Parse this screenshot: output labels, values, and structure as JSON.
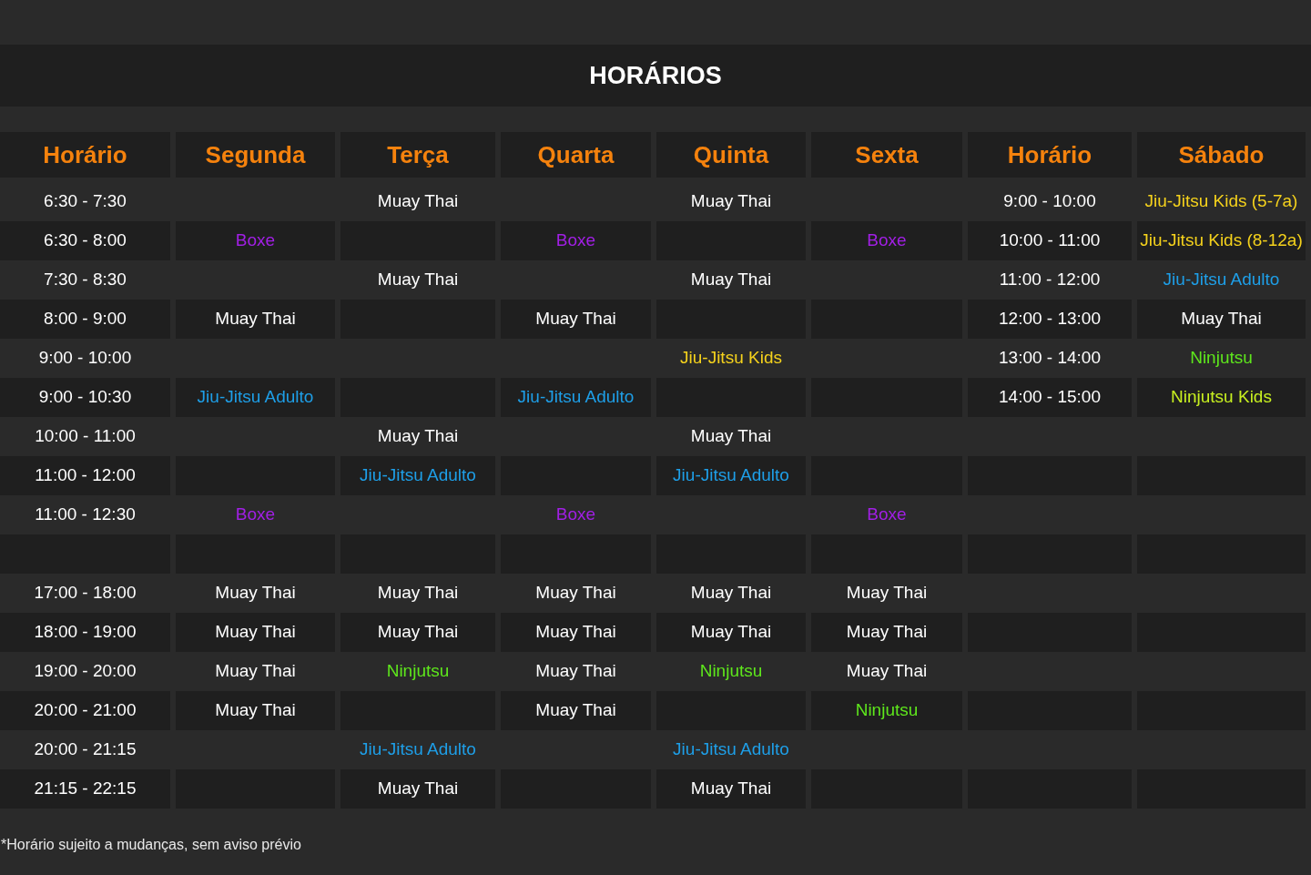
{
  "title": "HORÁRIOS",
  "columns": [
    "Horário",
    "Segunda",
    "Terça",
    "Quarta",
    "Quinta",
    "Sexta",
    "Horário",
    "Sábado"
  ],
  "rows": [
    {
      "cells": [
        {
          "text": "6:30 - 7:30",
          "color": "#ffffff"
        },
        null,
        {
          "text": "Muay Thai",
          "color": "#ffffff"
        },
        null,
        {
          "text": "Muay Thai",
          "color": "#ffffff"
        },
        null,
        {
          "text": "9:00 - 10:00",
          "color": "#ffffff"
        },
        {
          "text": "Jiu-Jitsu Kids (5-7a)",
          "color": "#f5d21c"
        }
      ]
    },
    {
      "cells": [
        {
          "text": "6:30 - 8:00",
          "color": "#ffffff"
        },
        {
          "text": "Boxe",
          "color": "#a21fe6"
        },
        null,
        {
          "text": "Boxe",
          "color": "#a21fe6"
        },
        null,
        {
          "text": "Boxe",
          "color": "#a21fe6"
        },
        {
          "text": "10:00 - 11:00",
          "color": "#ffffff"
        },
        {
          "text": "Jiu-Jitsu Kids (8-12a)",
          "color": "#f5d21c"
        }
      ]
    },
    {
      "cells": [
        {
          "text": "7:30 - 8:30",
          "color": "#ffffff"
        },
        null,
        {
          "text": "Muay Thai",
          "color": "#ffffff"
        },
        null,
        {
          "text": "Muay Thai",
          "color": "#ffffff"
        },
        null,
        {
          "text": "11:00 - 12:00",
          "color": "#ffffff"
        },
        {
          "text": "Jiu-Jitsu Adulto",
          "color": "#1e9fe8"
        }
      ]
    },
    {
      "cells": [
        {
          "text": "8:00 - 9:00",
          "color": "#ffffff"
        },
        {
          "text": "Muay Thai",
          "color": "#ffffff"
        },
        null,
        {
          "text": "Muay Thai",
          "color": "#ffffff"
        },
        null,
        null,
        {
          "text": "12:00 - 13:00",
          "color": "#ffffff"
        },
        {
          "text": "Muay Thai",
          "color": "#ffffff"
        }
      ]
    },
    {
      "cells": [
        {
          "text": "9:00 - 10:00",
          "color": "#ffffff"
        },
        null,
        null,
        null,
        {
          "text": "Jiu-Jitsu Kids",
          "color": "#f5d21c"
        },
        null,
        {
          "text": "13:00 - 14:00",
          "color": "#ffffff"
        },
        {
          "text": "Ninjutsu",
          "color": "#5ee61c"
        }
      ]
    },
    {
      "cells": [
        {
          "text": "9:00 - 10:30",
          "color": "#ffffff"
        },
        {
          "text": "Jiu-Jitsu Adulto",
          "color": "#1e9fe8"
        },
        null,
        {
          "text": "Jiu-Jitsu Adulto",
          "color": "#1e9fe8"
        },
        null,
        null,
        {
          "text": "14:00 - 15:00",
          "color": "#ffffff"
        },
        {
          "text": "Ninjutsu Kids",
          "color": "#c8f020"
        }
      ]
    },
    {
      "cells": [
        {
          "text": "10:00 - 11:00",
          "color": "#ffffff"
        },
        null,
        {
          "text": "Muay Thai",
          "color": "#ffffff"
        },
        null,
        {
          "text": "Muay Thai",
          "color": "#ffffff"
        },
        null,
        null,
        null
      ]
    },
    {
      "cells": [
        {
          "text": "11:00 - 12:00",
          "color": "#ffffff"
        },
        null,
        {
          "text": "Jiu-Jitsu Adulto",
          "color": "#1e9fe8"
        },
        null,
        {
          "text": "Jiu-Jitsu Adulto",
          "color": "#1e9fe8"
        },
        null,
        null,
        null
      ]
    },
    {
      "cells": [
        {
          "text": "11:00 - 12:30",
          "color": "#ffffff"
        },
        {
          "text": "Boxe",
          "color": "#a21fe6"
        },
        null,
        {
          "text": "Boxe",
          "color": "#a21fe6"
        },
        null,
        {
          "text": "Boxe",
          "color": "#a21fe6"
        },
        null,
        null
      ]
    },
    {
      "cells": [
        null,
        null,
        null,
        null,
        null,
        null,
        null,
        null
      ]
    },
    {
      "cells": [
        {
          "text": "17:00 - 18:00",
          "color": "#ffffff"
        },
        {
          "text": "Muay Thai",
          "color": "#ffffff"
        },
        {
          "text": "Muay Thai",
          "color": "#ffffff"
        },
        {
          "text": "Muay Thai",
          "color": "#ffffff"
        },
        {
          "text": "Muay Thai",
          "color": "#ffffff"
        },
        {
          "text": "Muay Thai",
          "color": "#ffffff"
        },
        null,
        null
      ]
    },
    {
      "cells": [
        {
          "text": "18:00 - 19:00",
          "color": "#ffffff"
        },
        {
          "text": "Muay Thai",
          "color": "#ffffff"
        },
        {
          "text": "Muay Thai",
          "color": "#ffffff"
        },
        {
          "text": "Muay Thai",
          "color": "#ffffff"
        },
        {
          "text": "Muay Thai",
          "color": "#ffffff"
        },
        {
          "text": "Muay Thai",
          "color": "#ffffff"
        },
        null,
        null
      ]
    },
    {
      "cells": [
        {
          "text": "19:00 - 20:00",
          "color": "#ffffff"
        },
        {
          "text": "Muay Thai",
          "color": "#ffffff"
        },
        {
          "text": "Ninjutsu",
          "color": "#5ee61c"
        },
        {
          "text": "Muay Thai",
          "color": "#ffffff"
        },
        {
          "text": "Ninjutsu",
          "color": "#5ee61c"
        },
        {
          "text": "Muay Thai",
          "color": "#ffffff"
        },
        null,
        null
      ]
    },
    {
      "cells": [
        {
          "text": "20:00 - 21:00",
          "color": "#ffffff"
        },
        {
          "text": "Muay Thai",
          "color": "#ffffff"
        },
        null,
        {
          "text": "Muay Thai",
          "color": "#ffffff"
        },
        null,
        {
          "text": "Ninjutsu",
          "color": "#5ee61c"
        },
        null,
        null
      ]
    },
    {
      "cells": [
        {
          "text": "20:00 - 21:15",
          "color": "#ffffff"
        },
        null,
        {
          "text": "Jiu-Jitsu Adulto",
          "color": "#1e9fe8"
        },
        null,
        {
          "text": "Jiu-Jitsu Adulto",
          "color": "#1e9fe8"
        },
        null,
        null,
        null
      ]
    },
    {
      "cells": [
        {
          "text": "21:15 - 22:15",
          "color": "#ffffff"
        },
        null,
        {
          "text": "Muay Thai",
          "color": "#ffffff"
        },
        null,
        {
          "text": "Muay Thai",
          "color": "#ffffff"
        },
        null,
        null,
        null
      ]
    }
  ],
  "footnote": "*Horário sujeito a mudanças, sem aviso prévio"
}
